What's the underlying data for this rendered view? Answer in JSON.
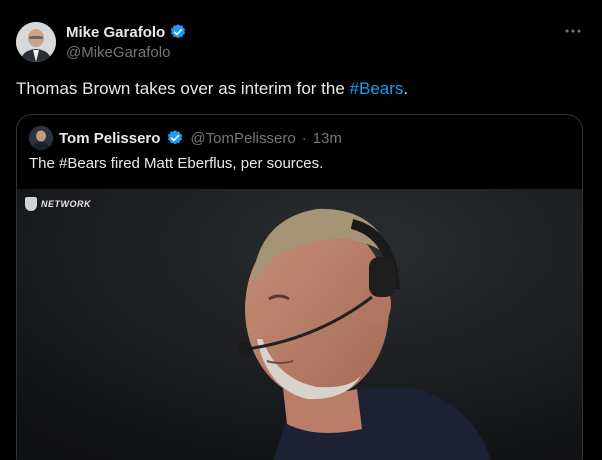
{
  "author": {
    "display_name": "Mike Garafolo",
    "handle": "@MikeGarafolo",
    "more_icon": "more-horizontal-icon"
  },
  "tweet": {
    "text_before": "Thomas Brown takes over as interim for the ",
    "hashtag": "#Bears",
    "text_after": "."
  },
  "quote": {
    "display_name": "Tom Pelissero",
    "handle": "@TomPelissero",
    "separator": "·",
    "time": "13m",
    "text": "The #Bears fired Matt Eberflus, per sources.",
    "media": {
      "watermark_text": "NETWORK"
    }
  },
  "colors": {
    "background": "#000000",
    "text": "#e7e9ea",
    "muted": "#71767b",
    "link": "#1d9bf0",
    "border": "#2f3336",
    "verified": "#1d9bf0"
  }
}
